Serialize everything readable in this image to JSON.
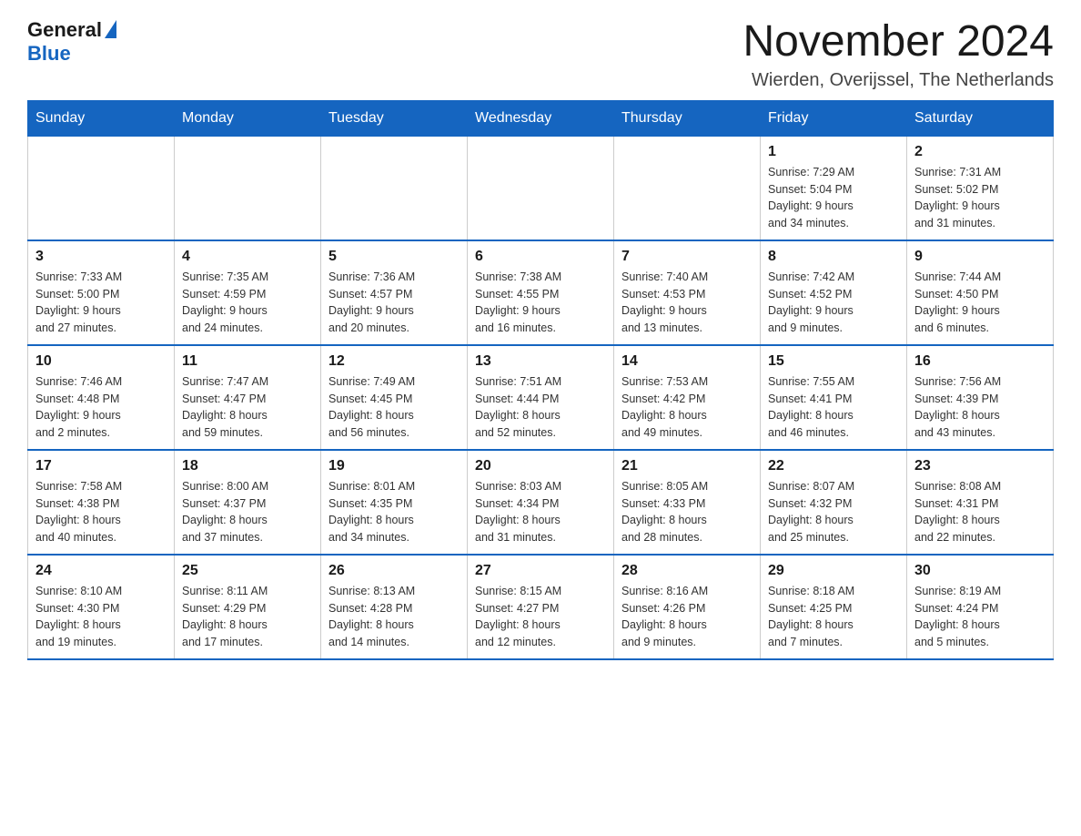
{
  "header": {
    "logo": {
      "text_general": "General",
      "text_blue": "Blue"
    },
    "month_title": "November 2024",
    "location": "Wierden, Overijssel, The Netherlands"
  },
  "weekdays": [
    "Sunday",
    "Monday",
    "Tuesday",
    "Wednesday",
    "Thursday",
    "Friday",
    "Saturday"
  ],
  "weeks": [
    [
      {
        "day": "",
        "info": ""
      },
      {
        "day": "",
        "info": ""
      },
      {
        "day": "",
        "info": ""
      },
      {
        "day": "",
        "info": ""
      },
      {
        "day": "",
        "info": ""
      },
      {
        "day": "1",
        "info": "Sunrise: 7:29 AM\nSunset: 5:04 PM\nDaylight: 9 hours\nand 34 minutes."
      },
      {
        "day": "2",
        "info": "Sunrise: 7:31 AM\nSunset: 5:02 PM\nDaylight: 9 hours\nand 31 minutes."
      }
    ],
    [
      {
        "day": "3",
        "info": "Sunrise: 7:33 AM\nSunset: 5:00 PM\nDaylight: 9 hours\nand 27 minutes."
      },
      {
        "day": "4",
        "info": "Sunrise: 7:35 AM\nSunset: 4:59 PM\nDaylight: 9 hours\nand 24 minutes."
      },
      {
        "day": "5",
        "info": "Sunrise: 7:36 AM\nSunset: 4:57 PM\nDaylight: 9 hours\nand 20 minutes."
      },
      {
        "day": "6",
        "info": "Sunrise: 7:38 AM\nSunset: 4:55 PM\nDaylight: 9 hours\nand 16 minutes."
      },
      {
        "day": "7",
        "info": "Sunrise: 7:40 AM\nSunset: 4:53 PM\nDaylight: 9 hours\nand 13 minutes."
      },
      {
        "day": "8",
        "info": "Sunrise: 7:42 AM\nSunset: 4:52 PM\nDaylight: 9 hours\nand 9 minutes."
      },
      {
        "day": "9",
        "info": "Sunrise: 7:44 AM\nSunset: 4:50 PM\nDaylight: 9 hours\nand 6 minutes."
      }
    ],
    [
      {
        "day": "10",
        "info": "Sunrise: 7:46 AM\nSunset: 4:48 PM\nDaylight: 9 hours\nand 2 minutes."
      },
      {
        "day": "11",
        "info": "Sunrise: 7:47 AM\nSunset: 4:47 PM\nDaylight: 8 hours\nand 59 minutes."
      },
      {
        "day": "12",
        "info": "Sunrise: 7:49 AM\nSunset: 4:45 PM\nDaylight: 8 hours\nand 56 minutes."
      },
      {
        "day": "13",
        "info": "Sunrise: 7:51 AM\nSunset: 4:44 PM\nDaylight: 8 hours\nand 52 minutes."
      },
      {
        "day": "14",
        "info": "Sunrise: 7:53 AM\nSunset: 4:42 PM\nDaylight: 8 hours\nand 49 minutes."
      },
      {
        "day": "15",
        "info": "Sunrise: 7:55 AM\nSunset: 4:41 PM\nDaylight: 8 hours\nand 46 minutes."
      },
      {
        "day": "16",
        "info": "Sunrise: 7:56 AM\nSunset: 4:39 PM\nDaylight: 8 hours\nand 43 minutes."
      }
    ],
    [
      {
        "day": "17",
        "info": "Sunrise: 7:58 AM\nSunset: 4:38 PM\nDaylight: 8 hours\nand 40 minutes."
      },
      {
        "day": "18",
        "info": "Sunrise: 8:00 AM\nSunset: 4:37 PM\nDaylight: 8 hours\nand 37 minutes."
      },
      {
        "day": "19",
        "info": "Sunrise: 8:01 AM\nSunset: 4:35 PM\nDaylight: 8 hours\nand 34 minutes."
      },
      {
        "day": "20",
        "info": "Sunrise: 8:03 AM\nSunset: 4:34 PM\nDaylight: 8 hours\nand 31 minutes."
      },
      {
        "day": "21",
        "info": "Sunrise: 8:05 AM\nSunset: 4:33 PM\nDaylight: 8 hours\nand 28 minutes."
      },
      {
        "day": "22",
        "info": "Sunrise: 8:07 AM\nSunset: 4:32 PM\nDaylight: 8 hours\nand 25 minutes."
      },
      {
        "day": "23",
        "info": "Sunrise: 8:08 AM\nSunset: 4:31 PM\nDaylight: 8 hours\nand 22 minutes."
      }
    ],
    [
      {
        "day": "24",
        "info": "Sunrise: 8:10 AM\nSunset: 4:30 PM\nDaylight: 8 hours\nand 19 minutes."
      },
      {
        "day": "25",
        "info": "Sunrise: 8:11 AM\nSunset: 4:29 PM\nDaylight: 8 hours\nand 17 minutes."
      },
      {
        "day": "26",
        "info": "Sunrise: 8:13 AM\nSunset: 4:28 PM\nDaylight: 8 hours\nand 14 minutes."
      },
      {
        "day": "27",
        "info": "Sunrise: 8:15 AM\nSunset: 4:27 PM\nDaylight: 8 hours\nand 12 minutes."
      },
      {
        "day": "28",
        "info": "Sunrise: 8:16 AM\nSunset: 4:26 PM\nDaylight: 8 hours\nand 9 minutes."
      },
      {
        "day": "29",
        "info": "Sunrise: 8:18 AM\nSunset: 4:25 PM\nDaylight: 8 hours\nand 7 minutes."
      },
      {
        "day": "30",
        "info": "Sunrise: 8:19 AM\nSunset: 4:24 PM\nDaylight: 8 hours\nand 5 minutes."
      }
    ]
  ]
}
